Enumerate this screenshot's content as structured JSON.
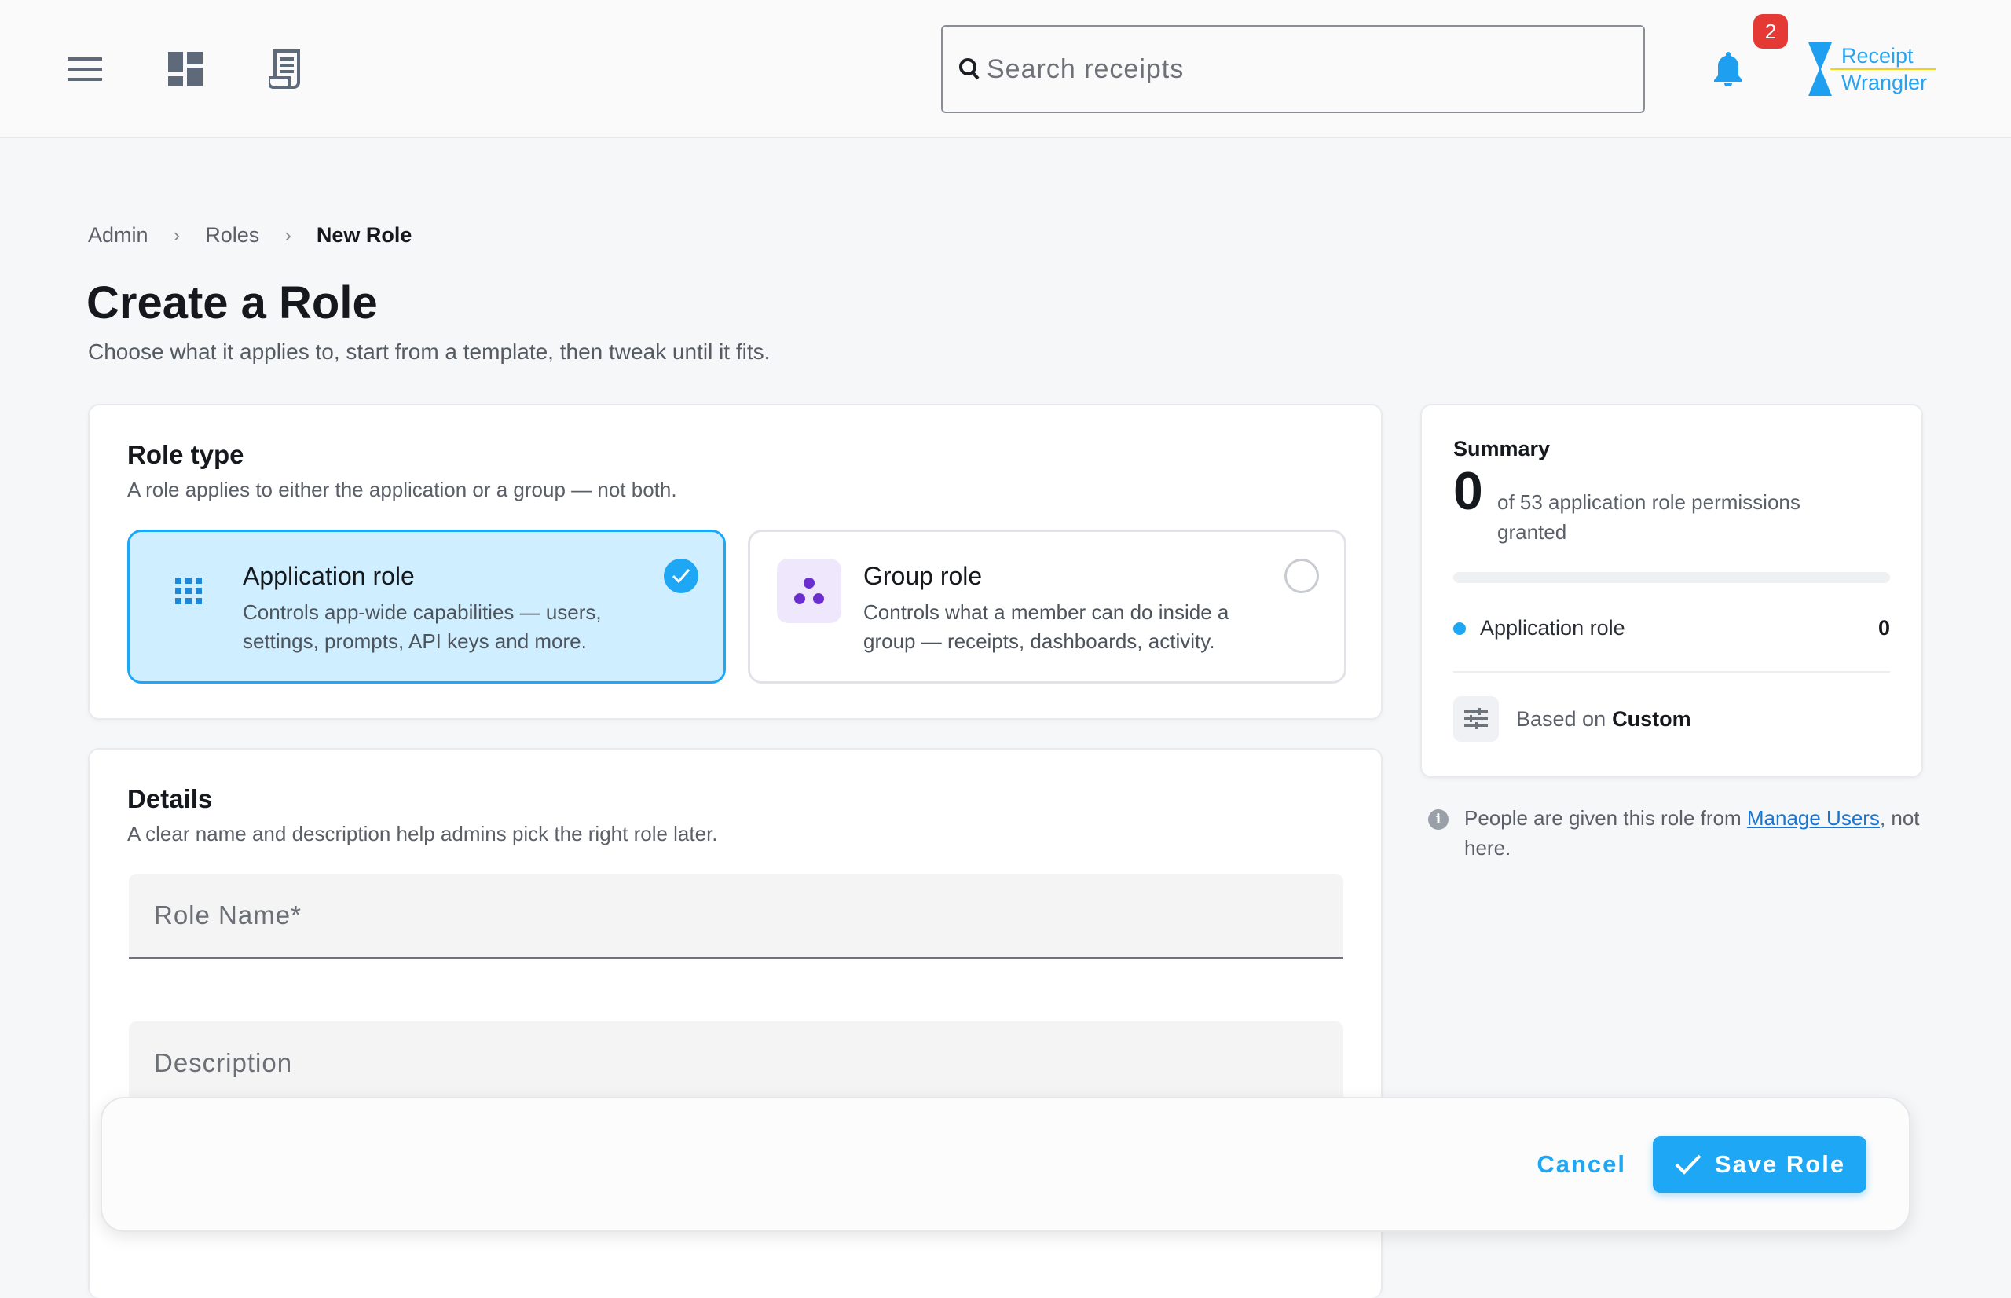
{
  "topbar": {
    "search_placeholder": "Search receipts",
    "notification_count": "2",
    "logo_line1": "Receipt",
    "logo_line2": "Wrangler"
  },
  "breadcrumb": [
    "Admin",
    "Roles",
    "New Role"
  ],
  "page": {
    "title": "Create a Role",
    "subtitle": "Choose what it applies to, start from a template, then tweak until it fits."
  },
  "role_type": {
    "title": "Role type",
    "subtitle": "A role applies to either the application or a group — not both.",
    "options": [
      {
        "title": "Application role",
        "description": "Controls app-wide capabilities — users, settings, prompts, API keys and more.",
        "selected": true
      },
      {
        "title": "Group role",
        "description": "Controls what a member can do inside a group — receipts, dashboards, activity.",
        "selected": false
      }
    ]
  },
  "details": {
    "title": "Details",
    "subtitle": "A clear name and description help admins pick the right role later.",
    "name_placeholder": "Role Name*",
    "description_placeholder": "Description"
  },
  "summary": {
    "title": "Summary",
    "granted": "0",
    "of_text": "of 53 application role permissions granted",
    "progress": 0,
    "row_label": "Application role",
    "row_count": "0",
    "based_on_label": "Based on",
    "based_on_value": "Custom"
  },
  "note": {
    "prefix": "People are given this role from ",
    "link": "Manage Users",
    "suffix": ", not here."
  },
  "footer": {
    "cancel": "Cancel",
    "save": "Save Role"
  },
  "colors": {
    "accent": "#1ea7f4",
    "selected_bg": "#cfeeff",
    "badge": "#e53935",
    "group_icon": "#6b2fd0"
  }
}
